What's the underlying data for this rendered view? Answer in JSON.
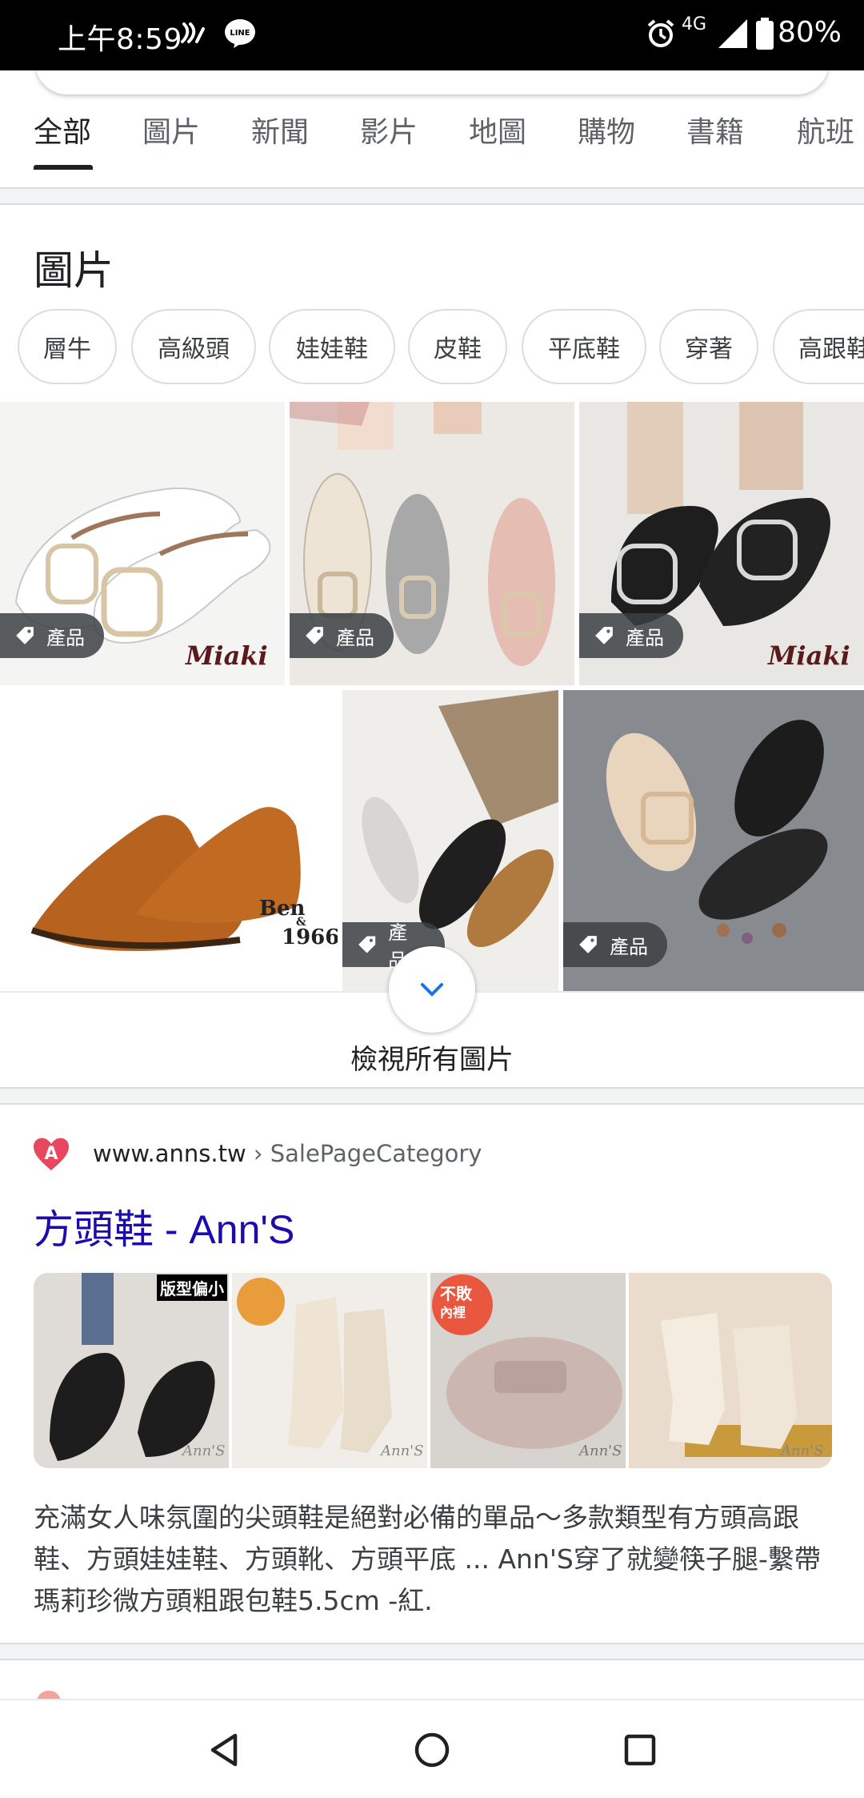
{
  "status_bar": {
    "time": "上午8:59",
    "network": "4G",
    "battery": "80%"
  },
  "tabs": [
    {
      "label": "全部",
      "active": true
    },
    {
      "label": "圖片",
      "active": false
    },
    {
      "label": "新聞",
      "active": false
    },
    {
      "label": "影片",
      "active": false
    },
    {
      "label": "地圖",
      "active": false
    },
    {
      "label": "購物",
      "active": false
    },
    {
      "label": "書籍",
      "active": false
    },
    {
      "label": "航班",
      "active": false
    }
  ],
  "images_section": {
    "title": "圖片",
    "chips": [
      "層牛",
      "高級頭",
      "娃娃鞋",
      "皮鞋",
      "平底鞋",
      "穿著",
      "高跟鞋"
    ],
    "product_tag": "產品",
    "brand_marks": [
      "Miaki",
      "Miaki",
      "Ben",
      "&",
      "1966"
    ],
    "view_all": "檢視所有圖片"
  },
  "result": {
    "site": "www.anns.tw",
    "crumb": "› SalePageCategory",
    "title": "方頭鞋 - Ann'S",
    "thumb_badges": [
      "版型偏小",
      "不敗",
      "內裡"
    ],
    "watermark": "Ann'S",
    "snippet": "充滿女人味氛圍的尖頭鞋是絕對必備的單品～多款類型有方頭高跟鞋、方頭娃娃鞋、方頭靴、方頭平底 ... Ann'S穿了就變筷子腿-繫帶瑪莉珍微方頭粗跟包鞋5.5cm -紅."
  },
  "colors": {
    "link": "#1a0dab",
    "accent": "#1a73e8",
    "status_bar": "#000000"
  }
}
